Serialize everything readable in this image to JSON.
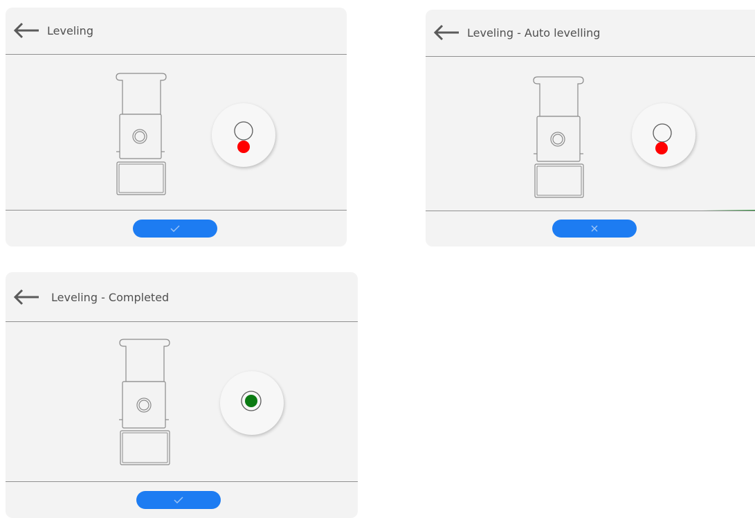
{
  "screens": [
    {
      "title": "Leveling",
      "button_icon": "check-icon",
      "bubble_state": "off-level",
      "bubble_color": "#ff0000"
    },
    {
      "title": "Leveling - Auto levelling",
      "button_icon": "close-icon",
      "bubble_state": "off-level",
      "bubble_color": "#ff0000",
      "progress_color": "#0a8a18"
    },
    {
      "title": "Leveling - Completed",
      "button_icon": "check-icon",
      "bubble_state": "level",
      "bubble_color": "#0a7a12"
    }
  ],
  "colors": {
    "accent": "#1d7cf2",
    "panel": "#f3f3f3",
    "line": "#8f8f8f"
  }
}
